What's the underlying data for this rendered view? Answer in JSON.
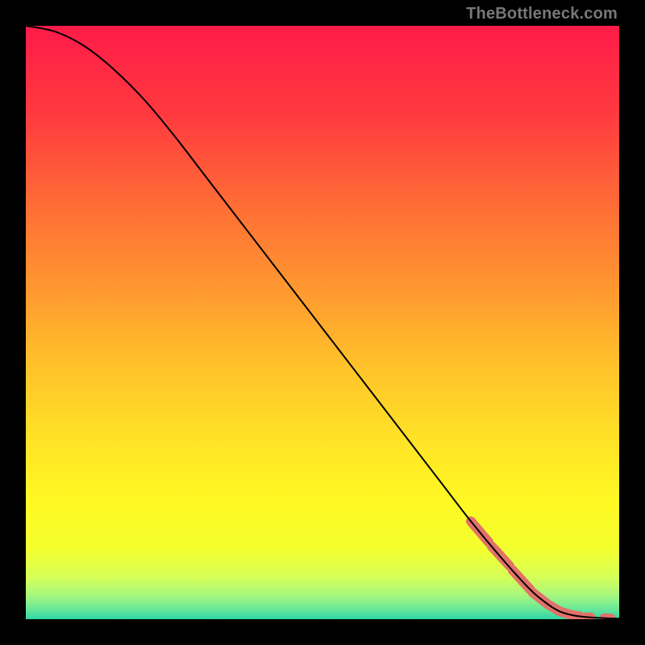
{
  "watermark": "TheBottleneck.com",
  "chart_data": {
    "type": "line",
    "title": "",
    "xlabel": "",
    "ylabel": "",
    "xlim": [
      0,
      100
    ],
    "ylim": [
      0,
      100
    ],
    "grid": false,
    "legend": false,
    "annotations": [],
    "series": [
      {
        "name": "curve",
        "x": [
          0,
          5,
          10,
          15,
          20,
          25,
          30,
          35,
          40,
          45,
          50,
          55,
          60,
          65,
          70,
          75,
          80,
          85,
          88,
          90,
          92,
          94,
          96,
          98,
          100
        ],
        "y": [
          100,
          99,
          96.5,
          92.5,
          87.5,
          81.5,
          75,
          68.5,
          62,
          55.5,
          49,
          42.5,
          36,
          29.5,
          23,
          16.5,
          10.5,
          5,
          2.5,
          1.3,
          0.7,
          0.4,
          0.25,
          0.15,
          0.1
        ],
        "color": "#000000",
        "stroke_width": 2
      }
    ],
    "markers": [
      {
        "name": "highlight-segments",
        "color": "#e2716a",
        "radius": 6,
        "segments": [
          {
            "x0": 75,
            "y0": 16.5,
            "x1": 78,
            "y1": 13
          },
          {
            "x0": 78.5,
            "y0": 12.3,
            "x1": 81.5,
            "y1": 9
          },
          {
            "x0": 82,
            "y0": 8.3,
            "x1": 85,
            "y1": 5
          },
          {
            "x0": 85.4,
            "y0": 4.5,
            "x1": 88,
            "y1": 2.5
          },
          {
            "x0": 88,
            "y0": 2.5,
            "x1": 90,
            "y1": 1.3
          },
          {
            "x0": 90,
            "y0": 1.3,
            "x1": 92,
            "y1": 0.7
          },
          {
            "x0": 92,
            "y0": 0.7,
            "x1": 93.3,
            "y1": 0.5
          },
          {
            "x0": 94.5,
            "y0": 0.35,
            "x1": 95.2,
            "y1": 0.3
          },
          {
            "x0": 97.5,
            "y0": 0.18,
            "x1": 98.6,
            "y1": 0.12
          }
        ]
      }
    ],
    "background_gradient": {
      "type": "vertical",
      "stops": [
        {
          "offset": 0.0,
          "color": "#ff1b49"
        },
        {
          "offset": 0.15,
          "color": "#ff3a3f"
        },
        {
          "offset": 0.3,
          "color": "#ff6c36"
        },
        {
          "offset": 0.45,
          "color": "#ff9a2f"
        },
        {
          "offset": 0.58,
          "color": "#ffc42a"
        },
        {
          "offset": 0.7,
          "color": "#ffe326"
        },
        {
          "offset": 0.8,
          "color": "#fff823"
        },
        {
          "offset": 0.88,
          "color": "#f3ff2d"
        },
        {
          "offset": 0.93,
          "color": "#d5ff58"
        },
        {
          "offset": 0.96,
          "color": "#a6f77e"
        },
        {
          "offset": 0.985,
          "color": "#63e69a"
        },
        {
          "offset": 1.0,
          "color": "#2fd6a4"
        }
      ]
    }
  }
}
